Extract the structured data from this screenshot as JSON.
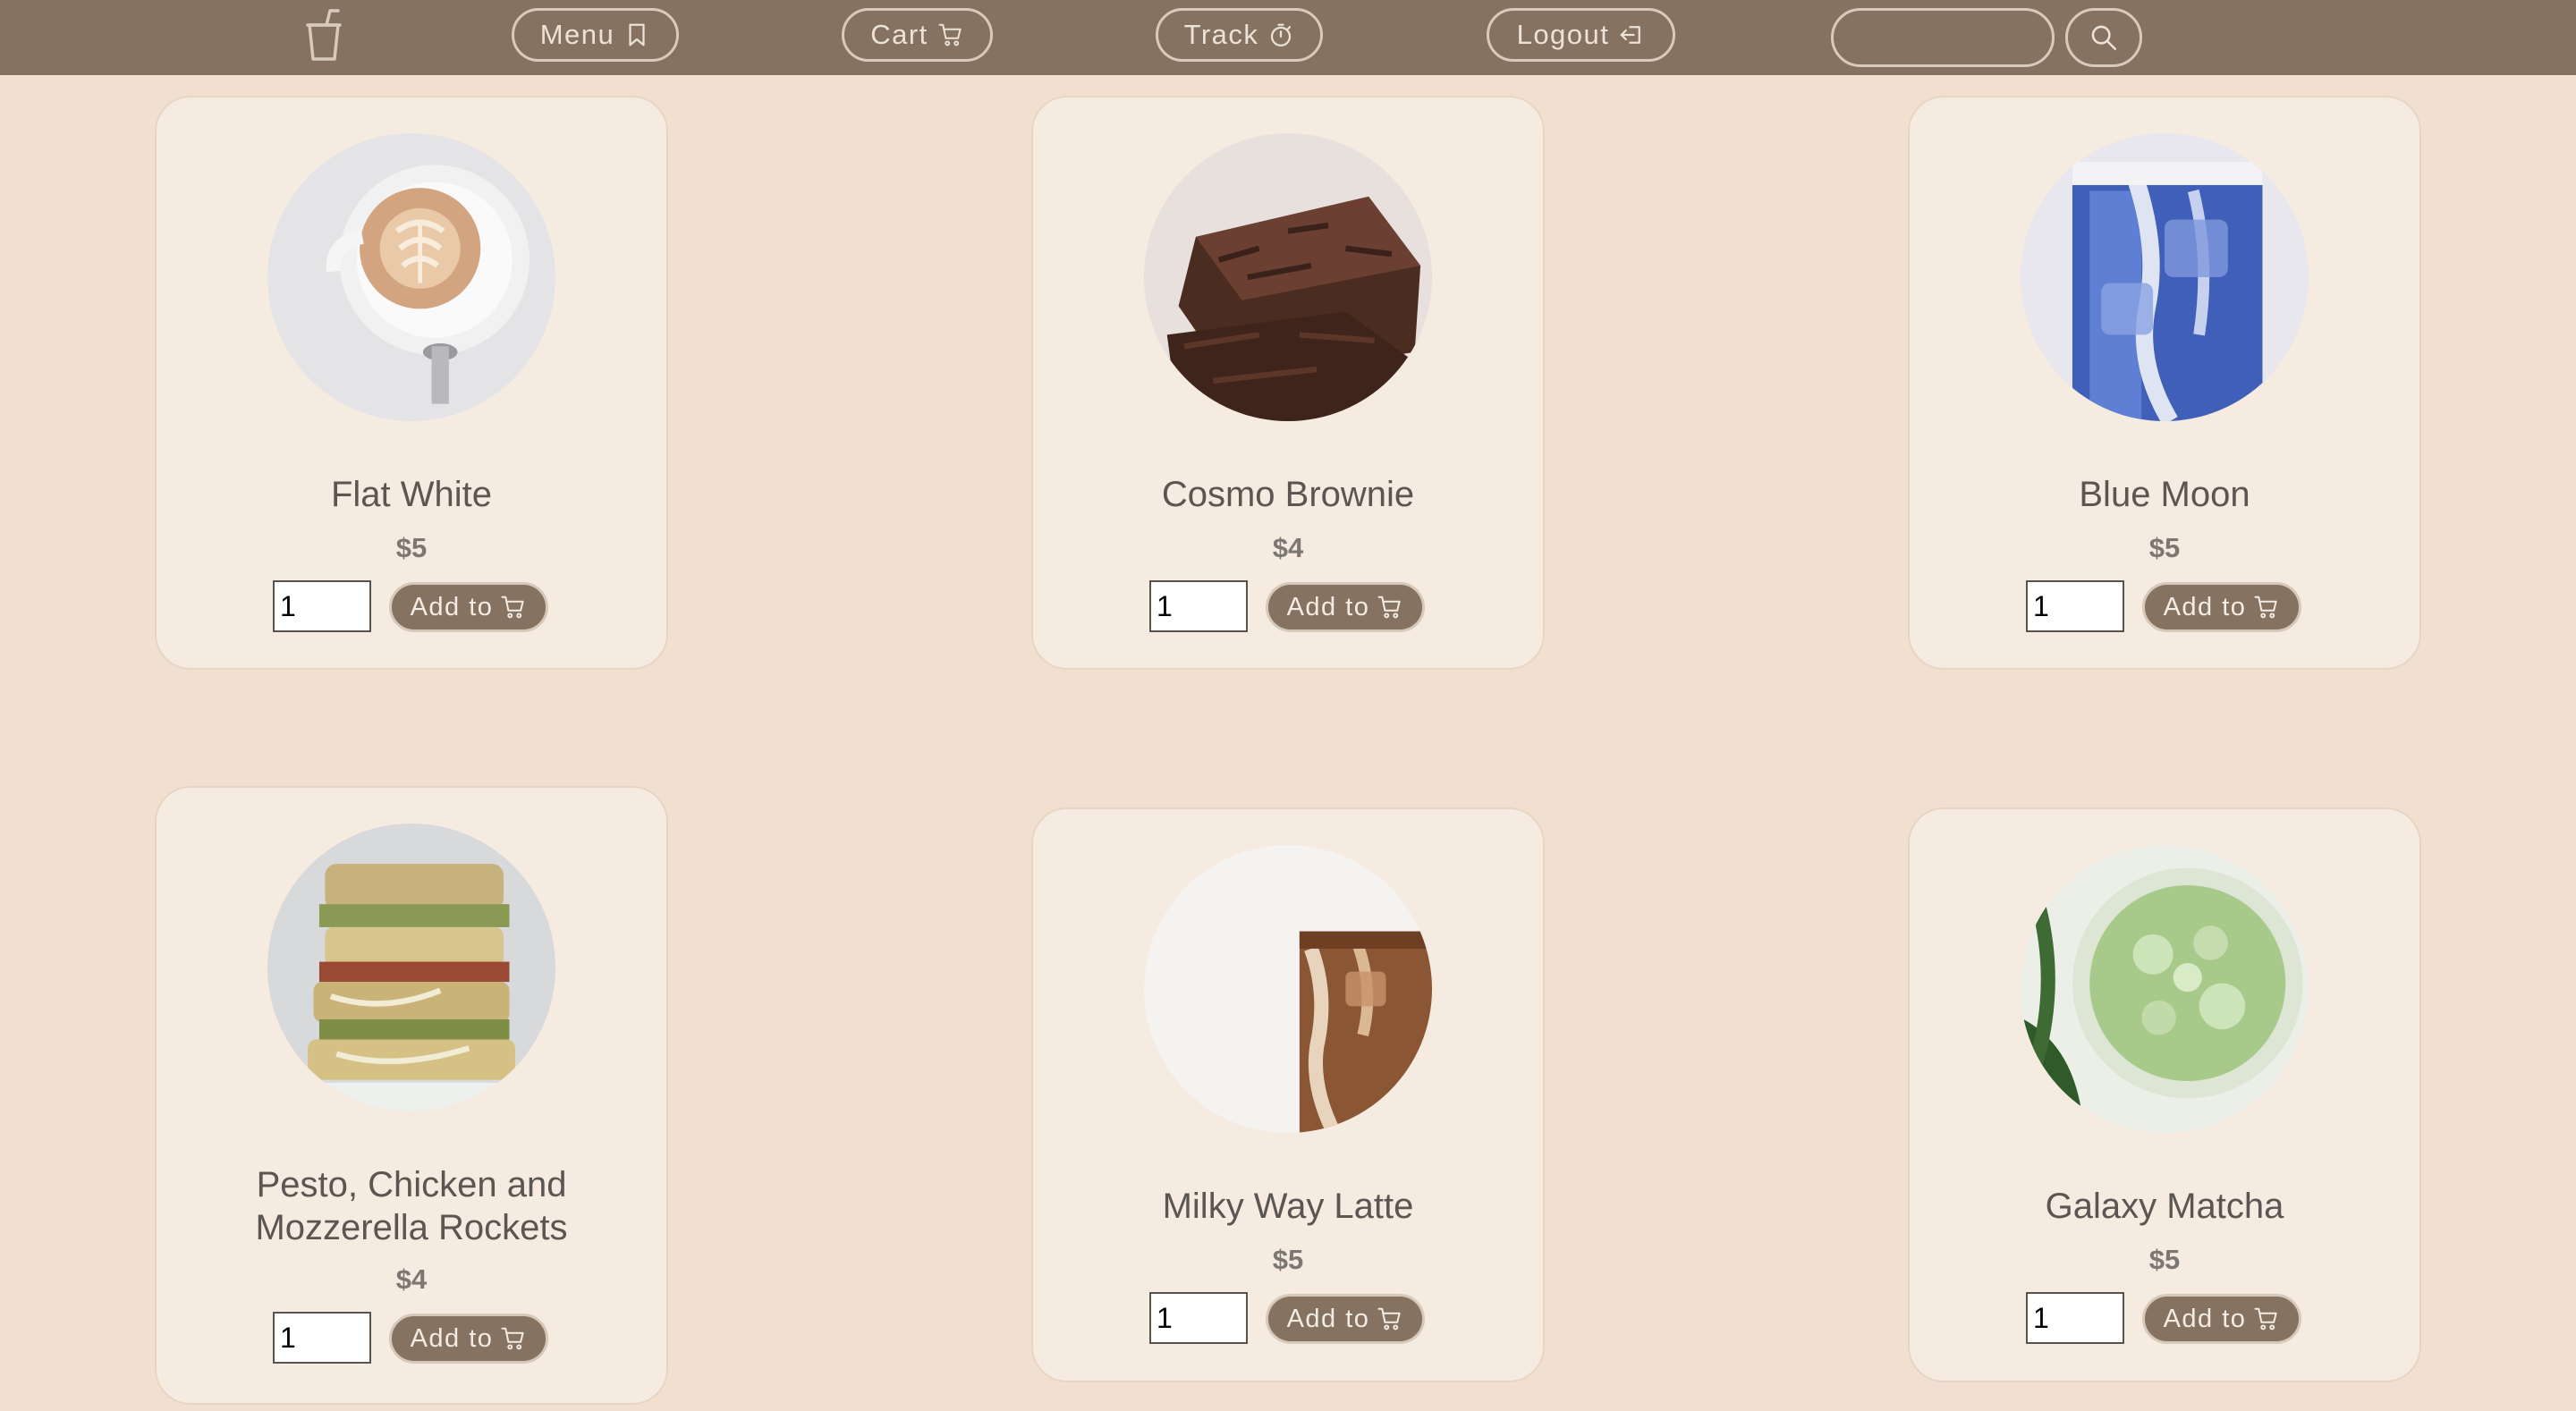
{
  "nav": {
    "logo_icon": "cup-with-straw-icon",
    "buttons": [
      {
        "label": "Menu",
        "icon": "bookmark-icon"
      },
      {
        "label": "Cart",
        "icon": "cart-icon"
      },
      {
        "label": "Track",
        "icon": "stopwatch-icon"
      },
      {
        "label": "Logout",
        "icon": "logout-icon"
      }
    ],
    "search": {
      "value": "",
      "placeholder": "",
      "button_icon": "search-icon"
    }
  },
  "products": [
    {
      "name": "Flat White",
      "price": "$5",
      "qty": "1",
      "add_label": "Add to",
      "image": "flat-white-photo"
    },
    {
      "name": "Cosmo Brownie",
      "price": "$4",
      "qty": "1",
      "add_label": "Add to",
      "image": "brownie-photo"
    },
    {
      "name": "Blue Moon",
      "price": "$5",
      "qty": "1",
      "add_label": "Add to",
      "image": "blue-drink-photo"
    },
    {
      "name": "Pesto, Chicken and Mozzerella Rockets",
      "price": "$4",
      "qty": "1",
      "add_label": "Add to",
      "image": "sandwich-photo"
    },
    {
      "name": "Milky Way Latte",
      "price": "$5",
      "qty": "1",
      "add_label": "Add to",
      "image": "iced-latte-photo"
    },
    {
      "name": "Galaxy Matcha",
      "price": "$5",
      "qty": "1",
      "add_label": "Add to",
      "image": "iced-matcha-photo"
    }
  ],
  "colors": {
    "page_bg": "#f1e0cf",
    "nav_bg": "#857260",
    "card_bg": "#f6ebe1",
    "button_bg": "#857260",
    "text": "#5b5651",
    "price_text": "#7c7773"
  }
}
